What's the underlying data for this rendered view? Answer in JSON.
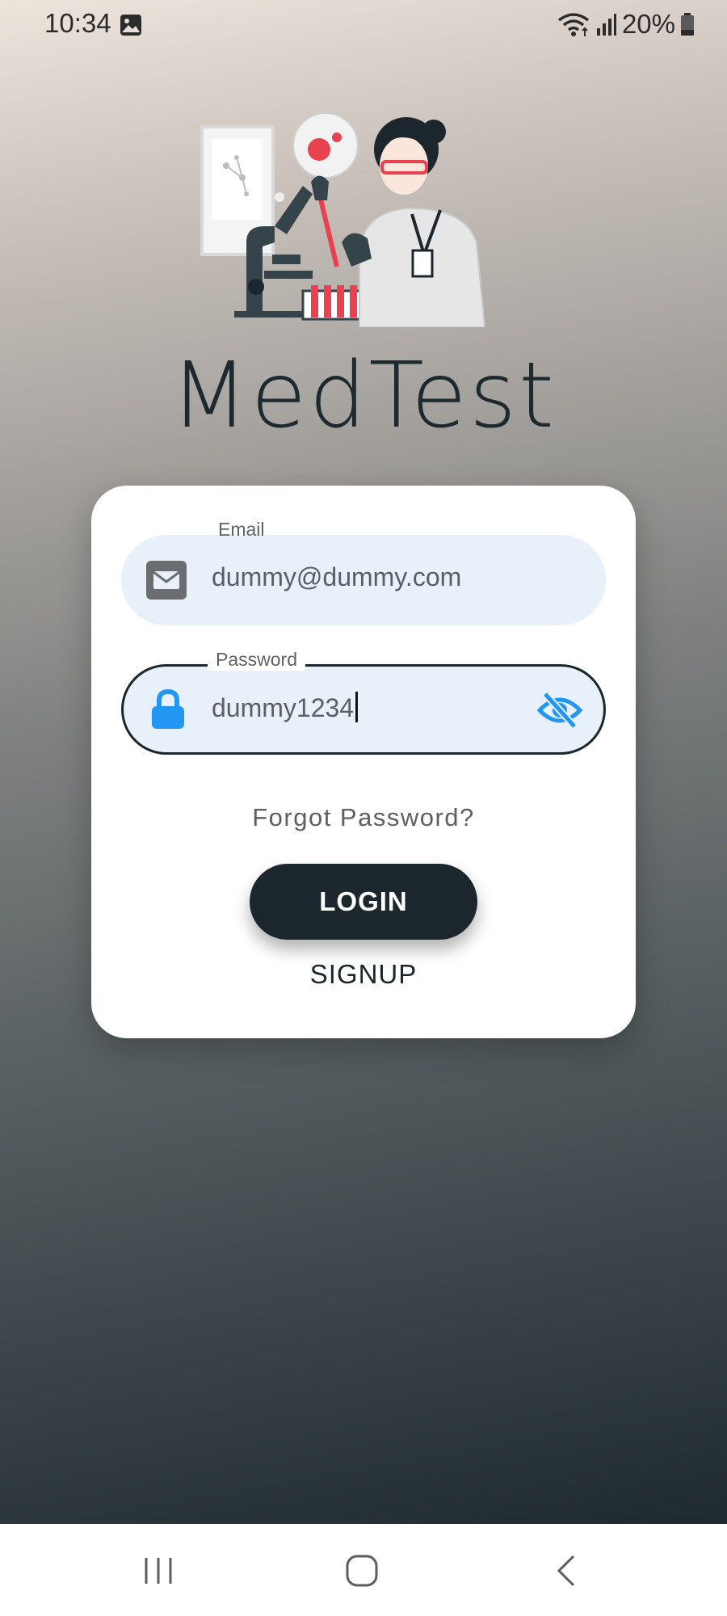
{
  "status_bar": {
    "time": "10:34",
    "battery": "20%",
    "icons": [
      "gallery-icon",
      "wifi-icon",
      "signal-icon",
      "battery-icon"
    ]
  },
  "app": {
    "title": "MedTest",
    "illustration": "lab-scientist-illustration"
  },
  "login_form": {
    "email": {
      "label": "Email",
      "value": "dummy@dummy.com",
      "icon": "mail-icon"
    },
    "password": {
      "label": "Password",
      "value": "dummy1234",
      "icon": "lock-icon",
      "toggle_icon": "eye-off-icon"
    },
    "forgot_label": "Forgot Password?",
    "login_label": "LOGIN",
    "signup_label": "SIGNUP"
  },
  "nav_bar": {
    "buttons": [
      "recent-apps-icon",
      "home-icon",
      "back-icon"
    ]
  },
  "colors": {
    "primary_dark": "#1c272d",
    "accent_blue": "#2196f3",
    "field_bg": "#e8f1fa",
    "gradient_top": "#ede4dc",
    "gradient_bottom": "#1f2a30"
  }
}
